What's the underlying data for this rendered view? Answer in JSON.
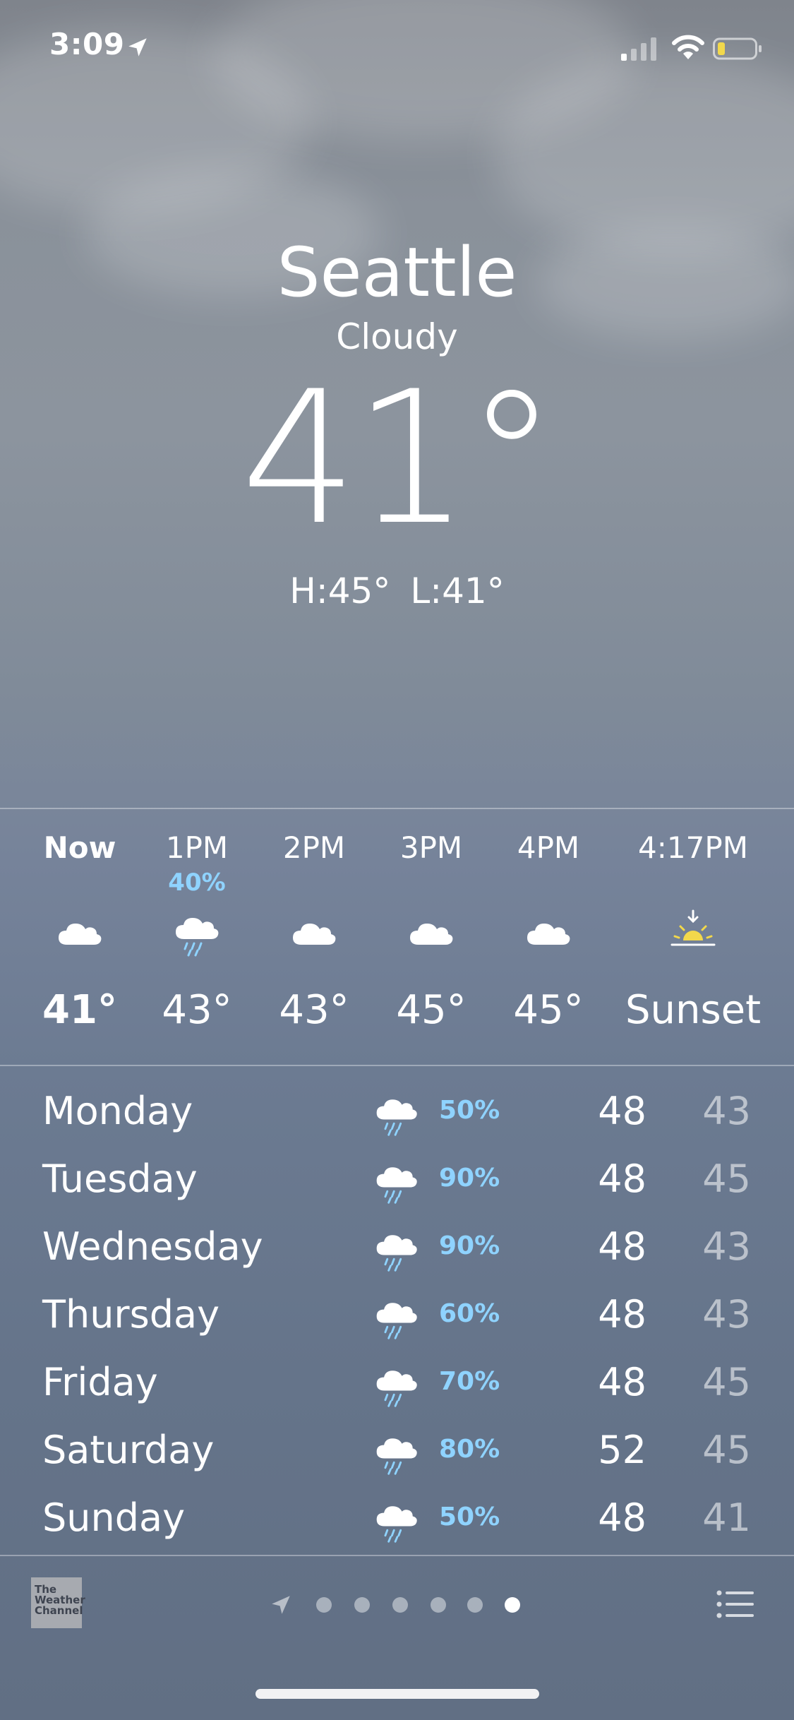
{
  "status_bar": {
    "time": "3:09",
    "location_icon": "location-arrow-icon",
    "signal_icon": "cellular-signal-icon",
    "wifi_icon": "wifi-icon",
    "battery_icon": "battery-low-icon",
    "battery_color": "#f2d84b"
  },
  "header": {
    "city": "Seattle",
    "condition": "Cloudy",
    "temperature": "41°",
    "high": "H:45°",
    "low": "L:41°"
  },
  "hourly": [
    {
      "time": "Now",
      "pop": "",
      "icon": "cloud-icon",
      "temp": "41°"
    },
    {
      "time": "1PM",
      "pop": "40%",
      "icon": "cloud-rain-icon",
      "temp": "43°"
    },
    {
      "time": "2PM",
      "pop": "",
      "icon": "cloud-icon",
      "temp": "43°"
    },
    {
      "time": "3PM",
      "pop": "",
      "icon": "cloud-icon",
      "temp": "45°"
    },
    {
      "time": "4PM",
      "pop": "",
      "icon": "cloud-icon",
      "temp": "45°"
    },
    {
      "time": "4:17PM",
      "pop": "",
      "icon": "sunset-icon",
      "temp": "Sunset"
    }
  ],
  "daily": [
    {
      "day": "Monday",
      "icon": "cloud-rain-icon",
      "pop": "50%",
      "high": "48",
      "low": "43"
    },
    {
      "day": "Tuesday",
      "icon": "cloud-rain-icon",
      "pop": "90%",
      "high": "48",
      "low": "45"
    },
    {
      "day": "Wednesday",
      "icon": "cloud-rain-icon",
      "pop": "90%",
      "high": "48",
      "low": "43"
    },
    {
      "day": "Thursday",
      "icon": "cloud-rain-icon",
      "pop": "60%",
      "high": "48",
      "low": "43"
    },
    {
      "day": "Friday",
      "icon": "cloud-rain-icon",
      "pop": "70%",
      "high": "48",
      "low": "45"
    },
    {
      "day": "Saturday",
      "icon": "cloud-rain-icon",
      "pop": "80%",
      "high": "52",
      "low": "45"
    },
    {
      "day": "Sunday",
      "icon": "cloud-rain-icon",
      "pop": "50%",
      "high": "48",
      "low": "41"
    }
  ],
  "footer": {
    "provider_logo_lines": [
      "The",
      "Weather",
      "Channel"
    ],
    "page_count": 6,
    "active_page": 6,
    "list_icon": "list-icon"
  },
  "colors": {
    "precip_text": "#8fd3ff",
    "sun": "#f2d84b",
    "rain": "#8fd3ff"
  }
}
